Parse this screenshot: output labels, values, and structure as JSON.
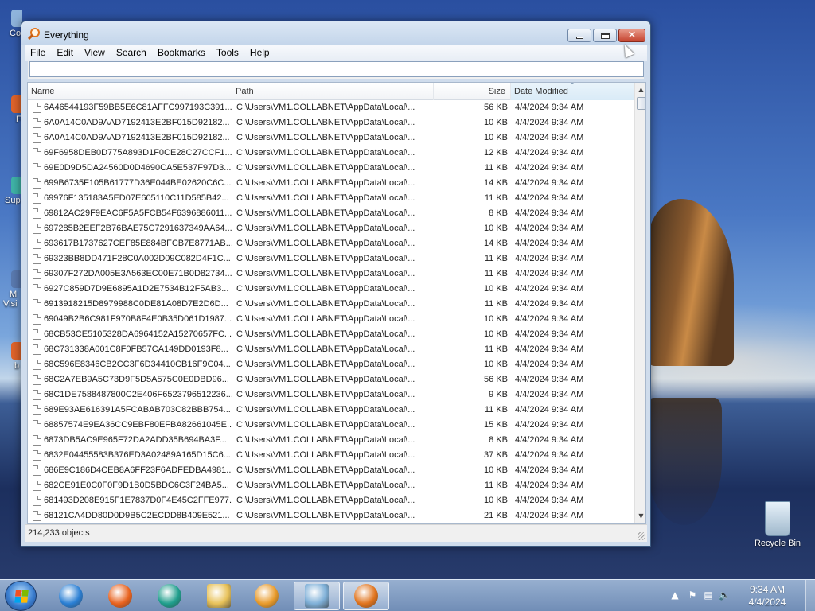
{
  "window": {
    "title": "Everything",
    "menu": [
      "File",
      "Edit",
      "View",
      "Search",
      "Bookmarks",
      "Tools",
      "Help"
    ],
    "search_value": "",
    "columns": {
      "name": "Name",
      "path": "Path",
      "size": "Size",
      "date": "Date Modified"
    },
    "sort_column": "Date Modified",
    "rows": [
      {
        "name": "6A46544193F59BB5E6C81AFFC997193C391...",
        "path": "C:\\Users\\VM1.COLLABNET\\AppData\\Local\\...",
        "size": "56 KB",
        "date": "4/4/2024 9:34 AM"
      },
      {
        "name": "6A0A14C0AD9AAD7192413E2BF015D92182...",
        "path": "C:\\Users\\VM1.COLLABNET\\AppData\\Local\\...",
        "size": "10 KB",
        "date": "4/4/2024 9:34 AM"
      },
      {
        "name": "6A0A14C0AD9AAD7192413E2BF015D92182...",
        "path": "C:\\Users\\VM1.COLLABNET\\AppData\\Local\\...",
        "size": "10 KB",
        "date": "4/4/2024 9:34 AM"
      },
      {
        "name": "69F6958DEB0D775A893D1F0CE28C27CCF1...",
        "path": "C:\\Users\\VM1.COLLABNET\\AppData\\Local\\...",
        "size": "12 KB",
        "date": "4/4/2024 9:34 AM"
      },
      {
        "name": "69E0D9D5DA24560D0D4690CA5E537F97D3...",
        "path": "C:\\Users\\VM1.COLLABNET\\AppData\\Local\\...",
        "size": "11 KB",
        "date": "4/4/2024 9:34 AM"
      },
      {
        "name": "699B6735F105B61777D36E044BE02620C6C...",
        "path": "C:\\Users\\VM1.COLLABNET\\AppData\\Local\\...",
        "size": "14 KB",
        "date": "4/4/2024 9:34 AM"
      },
      {
        "name": "69976F135183A5ED07E605110C11D585B42...",
        "path": "C:\\Users\\VM1.COLLABNET\\AppData\\Local\\...",
        "size": "11 KB",
        "date": "4/4/2024 9:34 AM"
      },
      {
        "name": "69812AC29F9EAC6F5A5FCB54F6396886011...",
        "path": "C:\\Users\\VM1.COLLABNET\\AppData\\Local\\...",
        "size": "8 KB",
        "date": "4/4/2024 9:34 AM"
      },
      {
        "name": "697285B2EEF2B76BAE75C7291637349AA64...",
        "path": "C:\\Users\\VM1.COLLABNET\\AppData\\Local\\...",
        "size": "10 KB",
        "date": "4/4/2024 9:34 AM"
      },
      {
        "name": "693617B1737627CEF85E884BFCB7E8771AB...",
        "path": "C:\\Users\\VM1.COLLABNET\\AppData\\Local\\...",
        "size": "14 KB",
        "date": "4/4/2024 9:34 AM"
      },
      {
        "name": "69323BB8DD471F28C0A002D09C082D4F1C...",
        "path": "C:\\Users\\VM1.COLLABNET\\AppData\\Local\\...",
        "size": "11 KB",
        "date": "4/4/2024 9:34 AM"
      },
      {
        "name": "69307F272DA005E3A563EC00E71B0D82734...",
        "path": "C:\\Users\\VM1.COLLABNET\\AppData\\Local\\...",
        "size": "11 KB",
        "date": "4/4/2024 9:34 AM"
      },
      {
        "name": "6927C859D7D9E6895A1D2E7534B12F5AB3...",
        "path": "C:\\Users\\VM1.COLLABNET\\AppData\\Local\\...",
        "size": "10 KB",
        "date": "4/4/2024 9:34 AM"
      },
      {
        "name": "6913918215D8979988C0DE81A08D7E2D6D...",
        "path": "C:\\Users\\VM1.COLLABNET\\AppData\\Local\\...",
        "size": "11 KB",
        "date": "4/4/2024 9:34 AM"
      },
      {
        "name": "69049B2B6C981F970B8F4E0B35D061D1987...",
        "path": "C:\\Users\\VM1.COLLABNET\\AppData\\Local\\...",
        "size": "10 KB",
        "date": "4/4/2024 9:34 AM"
      },
      {
        "name": "68CB53CE5105328DA6964152A15270657FC...",
        "path": "C:\\Users\\VM1.COLLABNET\\AppData\\Local\\...",
        "size": "10 KB",
        "date": "4/4/2024 9:34 AM"
      },
      {
        "name": "68C731338A001C8F0FB57CA149DD0193F8...",
        "path": "C:\\Users\\VM1.COLLABNET\\AppData\\Local\\...",
        "size": "11 KB",
        "date": "4/4/2024 9:34 AM"
      },
      {
        "name": "68C596E8346CB2CC3F6D34410CB16F9C04...",
        "path": "C:\\Users\\VM1.COLLABNET\\AppData\\Local\\...",
        "size": "10 KB",
        "date": "4/4/2024 9:34 AM"
      },
      {
        "name": "68C2A7EB9A5C73D9F5D5A575C0E0DBD96...",
        "path": "C:\\Users\\VM1.COLLABNET\\AppData\\Local\\...",
        "size": "56 KB",
        "date": "4/4/2024 9:34 AM"
      },
      {
        "name": "68C1DE7588487800C2E406F6523796512236...",
        "path": "C:\\Users\\VM1.COLLABNET\\AppData\\Local\\...",
        "size": "9 KB",
        "date": "4/4/2024 9:34 AM"
      },
      {
        "name": "689E93AE616391A5FCABAB703C82BBB754...",
        "path": "C:\\Users\\VM1.COLLABNET\\AppData\\Local\\...",
        "size": "11 KB",
        "date": "4/4/2024 9:34 AM"
      },
      {
        "name": "68857574E9EA36CC9EBF80EFBA82661045E...",
        "path": "C:\\Users\\VM1.COLLABNET\\AppData\\Local\\...",
        "size": "15 KB",
        "date": "4/4/2024 9:34 AM"
      },
      {
        "name": "6873DB5AC9E965F72DA2ADD35B694BA3F...",
        "path": "C:\\Users\\VM1.COLLABNET\\AppData\\Local\\...",
        "size": "8 KB",
        "date": "4/4/2024 9:34 AM"
      },
      {
        "name": "6832E04455583B376ED3A02489A165D15C6...",
        "path": "C:\\Users\\VM1.COLLABNET\\AppData\\Local\\...",
        "size": "37 KB",
        "date": "4/4/2024 9:34 AM"
      },
      {
        "name": "686E9C186D4CEB8A6FF23F6ADFEDBA4981...",
        "path": "C:\\Users\\VM1.COLLABNET\\AppData\\Local\\...",
        "size": "10 KB",
        "date": "4/4/2024 9:34 AM"
      },
      {
        "name": "682CE91E0C0F0F9D1B0D5BDC6C3F24BA5...",
        "path": "C:\\Users\\VM1.COLLABNET\\AppData\\Local\\...",
        "size": "11 KB",
        "date": "4/4/2024 9:34 AM"
      },
      {
        "name": "681493D208E915F1E7837D0F4E45C2FFE977...",
        "path": "C:\\Users\\VM1.COLLABNET\\AppData\\Local\\...",
        "size": "10 KB",
        "date": "4/4/2024 9:34 AM"
      },
      {
        "name": "68121CA4DD80D0D9B5C2ECDD8B409E521...",
        "path": "C:\\Users\\VM1.COLLABNET\\AppData\\Local\\...",
        "size": "21 KB",
        "date": "4/4/2024 9:34 AM"
      }
    ],
    "status": "214,233 objects"
  },
  "desktop": {
    "icons": [
      {
        "label": "Recycle Bin",
        "icon": "recycle-bin-icon"
      }
    ],
    "left_partial_labels": [
      "Co",
      "F",
      "Sup",
      "M",
      "Visi",
      "b"
    ]
  },
  "taskbar": {
    "apps": [
      {
        "name": "internet-explorer",
        "icon": "internet-explorer-icon",
        "color": "#2a7fd4"
      },
      {
        "name": "firefox",
        "icon": "firefox-icon",
        "color": "#e8621e"
      },
      {
        "name": "edge",
        "icon": "edge-icon",
        "color": "#1f9e8c"
      },
      {
        "name": "file-explorer",
        "icon": "folder-icon",
        "color": "#e8c25a"
      },
      {
        "name": "media-player",
        "icon": "media-player-icon",
        "color": "#e89a2a"
      },
      {
        "name": "notepad",
        "icon": "notepad-icon",
        "color": "#7fb0d8"
      },
      {
        "name": "everything",
        "icon": "everything-search-icon",
        "color": "#e0731c"
      }
    ],
    "active_apps": [
      "notepad",
      "everything"
    ],
    "clock_time": "9:34 AM",
    "clock_date": "4/4/2024"
  }
}
